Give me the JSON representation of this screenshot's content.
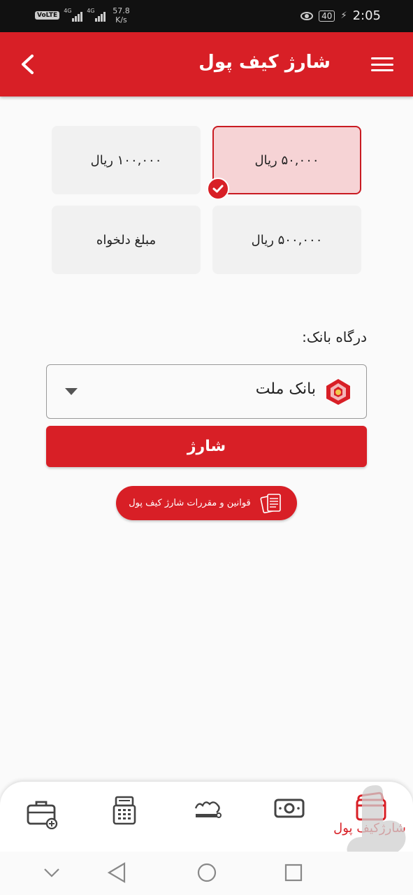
{
  "status_bar": {
    "volte": "VoLTE",
    "network_1": "4G",
    "network_2": "4G",
    "speed_value": "57.8",
    "speed_unit": "K/s",
    "battery": "40",
    "time": "2:05"
  },
  "app_bar": {
    "title": "شارژ کیف پول",
    "back_icon": "chevron-left-icon",
    "menu_icon": "hamburger-menu-icon"
  },
  "amounts": [
    {
      "label": "۵۰,۰۰۰ ریال",
      "selected": true
    },
    {
      "label": "۱۰۰,۰۰۰ ریال",
      "selected": false
    },
    {
      "label": "۵۰۰,۰۰۰ ریال",
      "selected": false
    },
    {
      "label": "مبلغ دلخواه",
      "selected": false
    }
  ],
  "gateway": {
    "label": "درگاه بانک:",
    "selected_bank": "بانک ملت"
  },
  "charge_button": "شارژ",
  "rules_button": "قوانین و مقررات شارژ کیف پول",
  "bottom_nav": {
    "items": [
      {
        "icon": "wallet-charge-icon",
        "label": "شارژکیف پول",
        "active": true
      },
      {
        "icon": "cash-icon",
        "active": false
      },
      {
        "icon": "restaurant-logo-icon",
        "active": false
      },
      {
        "icon": "receipt-icon",
        "active": false
      },
      {
        "icon": "briefcase-add-icon",
        "active": false
      }
    ]
  },
  "colors": {
    "primary": "#d81f26",
    "selected_card_bg": "#f6d3d5",
    "card_bg": "#f1f1f1"
  }
}
